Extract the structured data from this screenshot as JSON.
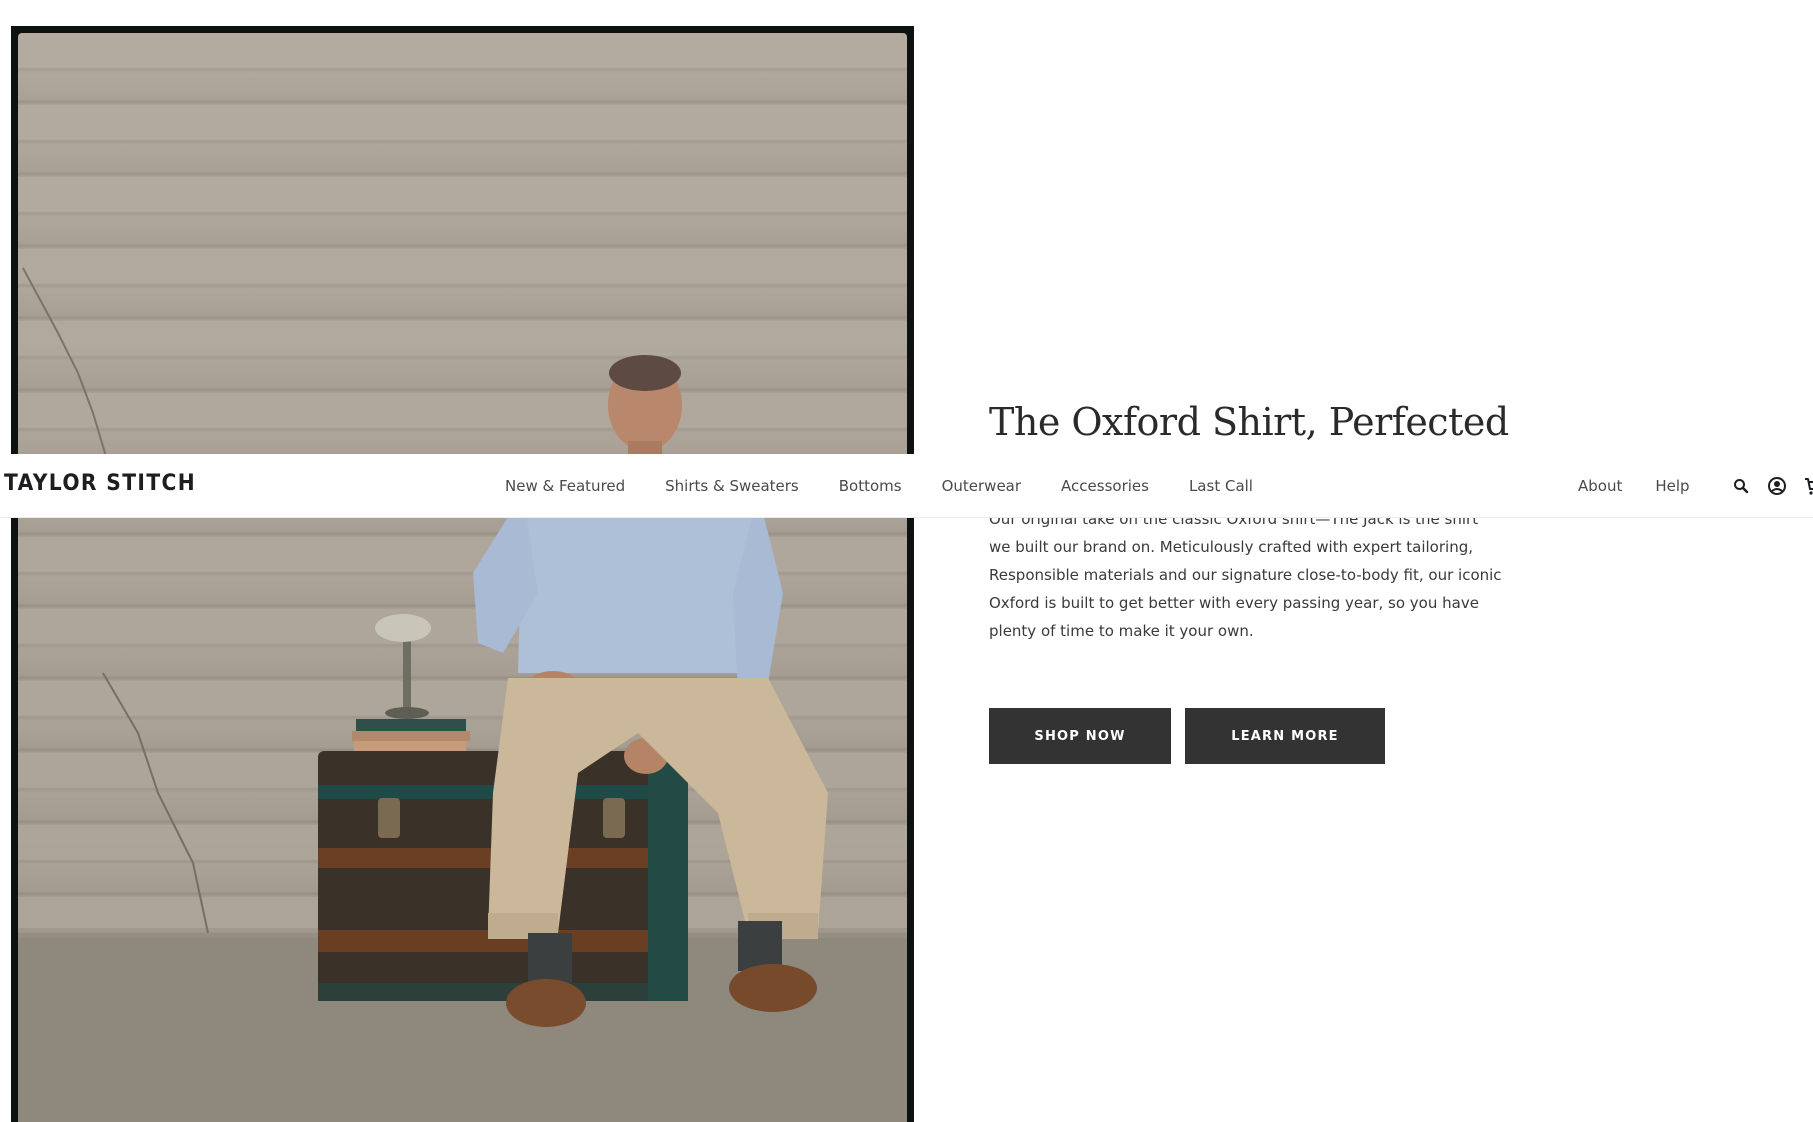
{
  "brand": {
    "logo_text": "TAYLOR STITCH"
  },
  "nav": {
    "main_items": [
      {
        "label": "New & Featured"
      },
      {
        "label": "Shirts & Sweaters"
      },
      {
        "label": "Bottoms"
      },
      {
        "label": "Outerwear"
      },
      {
        "label": "Accessories"
      },
      {
        "label": "Last Call"
      }
    ],
    "secondary_items": [
      {
        "label": "About"
      },
      {
        "label": "Help"
      }
    ],
    "icons": [
      "search-icon",
      "account-icon",
      "cart-icon"
    ]
  },
  "hero": {
    "headline": "The Oxford Shirt, Perfected",
    "body": "Our original take on the classic Oxford shirt—The Jack is the shirt we built our brand on. Meticulously crafted with expert tailoring, Responsible materials and our signature close-to-body fit, our iconic Oxford is built to get better with every passing year, so you have plenty of time to make it your own.",
    "primary_button": "SHOP NOW",
    "secondary_button": "LEARN MORE"
  },
  "colors": {
    "button_bg": "#333333",
    "button_text": "#ffffff",
    "logo": "#1c1e21",
    "nav_text": "#4a4a4a"
  }
}
